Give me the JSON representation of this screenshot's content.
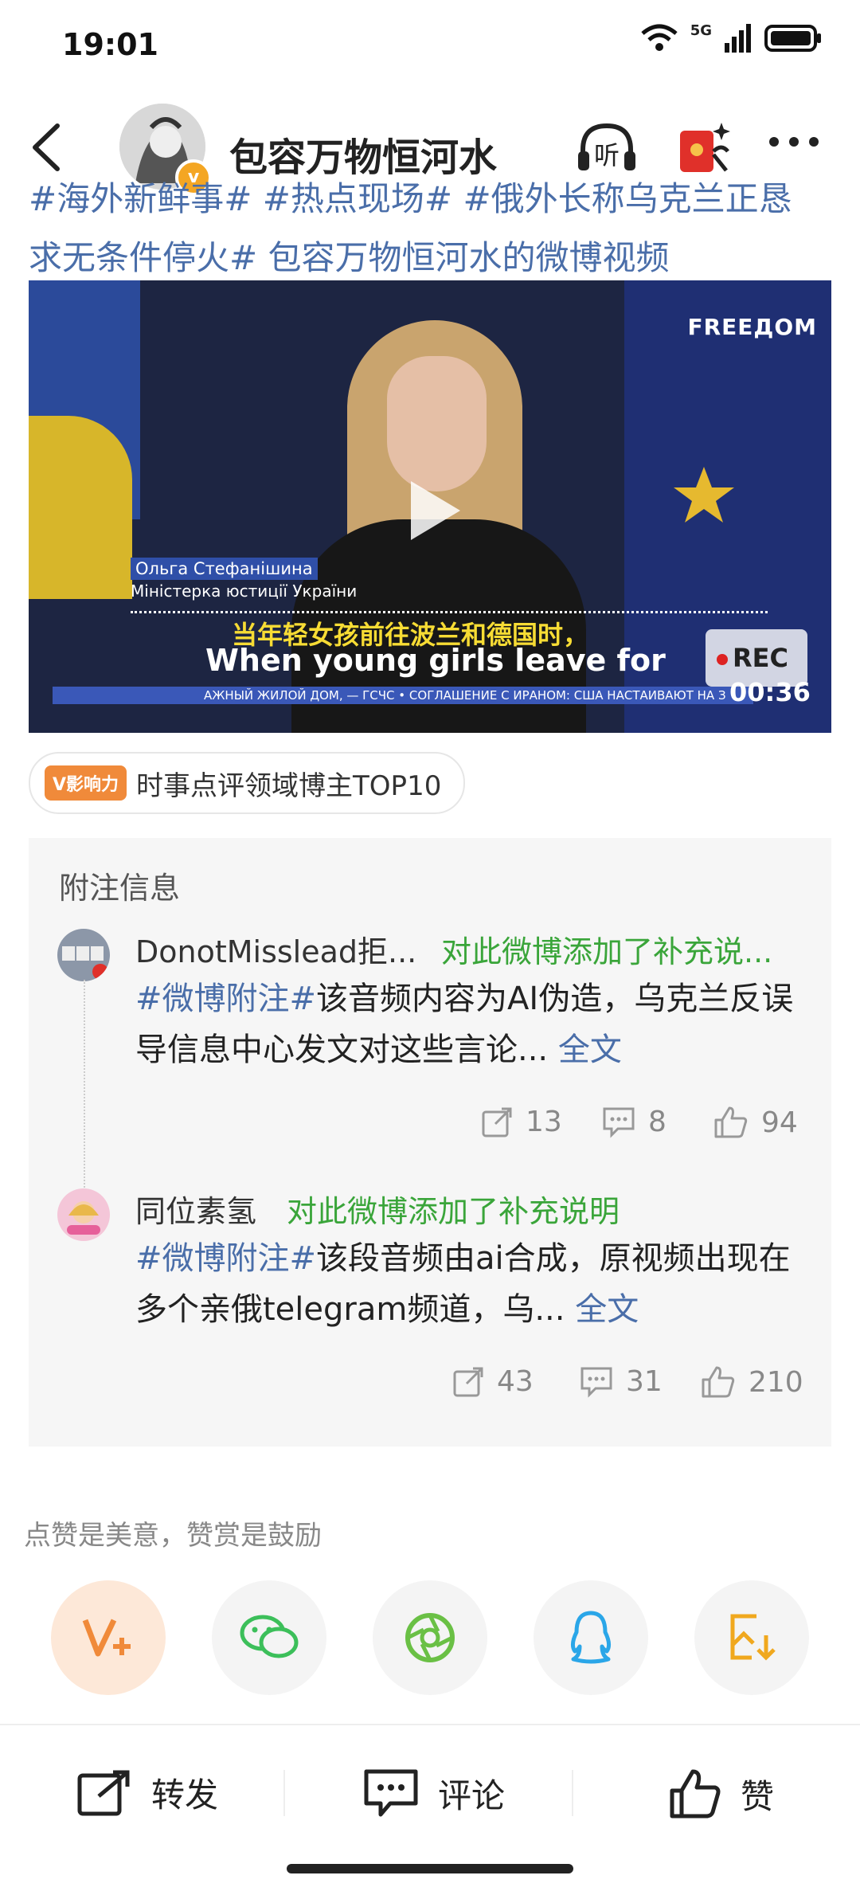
{
  "status_bar": {
    "time": "19:01",
    "network": "5G"
  },
  "header": {
    "author_name": "包容万物恒河水",
    "listen_label": "听"
  },
  "post": {
    "hashtag_line1": "#海外新鲜事# #热点现场# #俄外长称乌克兰正恳",
    "hashtag_line2": "求无条件停火# 包容万物恒河水的微博视频"
  },
  "video": {
    "brand": "FREEДOM",
    "caption_name": "Ольга Стефанішина",
    "caption_title": "Міністерка юстиції України",
    "subtitle_cn": "当年轻女孩前往波兰和德国时，",
    "subtitle_en": "When young girls leave for",
    "ticker": "АЖНЫЙ ЖИЛОЙ ДОМ, — ГСЧС  • СОГЛАШЕНИЕ С ИРАНОМ: США НАСТАИВАЮТ НА З",
    "rec_label": "REC",
    "duration": "00:36"
  },
  "influence": {
    "badge": "V影响力",
    "text": "时事点评领域博主TOP10"
  },
  "notes": {
    "title": "附注信息",
    "items": [
      {
        "name": "DonotMisslead拒...",
        "note": "对此微博添加了补充说...",
        "tag": "#微博附注#",
        "body": "该音频内容为AI伪造，乌克兰反误导信息中心发文对这些言论...",
        "more": "全文",
        "reposts": "13",
        "comments": "8",
        "likes": "94"
      },
      {
        "name": "同位素氢",
        "note": "对此微博添加了补充说明",
        "tag": "#微博附注#",
        "body": "该段音频由ai合成，原视频出现在多个亲俄telegram频道，乌...",
        "more": "全文",
        "reposts": "43",
        "comments": "31",
        "likes": "210"
      }
    ]
  },
  "encourage_text": "点赞是美意，赞赏是鼓励",
  "bottom_bar": {
    "repost": "转发",
    "comment": "评论",
    "like": "赞"
  },
  "colors": {
    "link": "#4a6ea9",
    "note_green": "#3aa53a",
    "accent_orange": "#f08a3a"
  }
}
